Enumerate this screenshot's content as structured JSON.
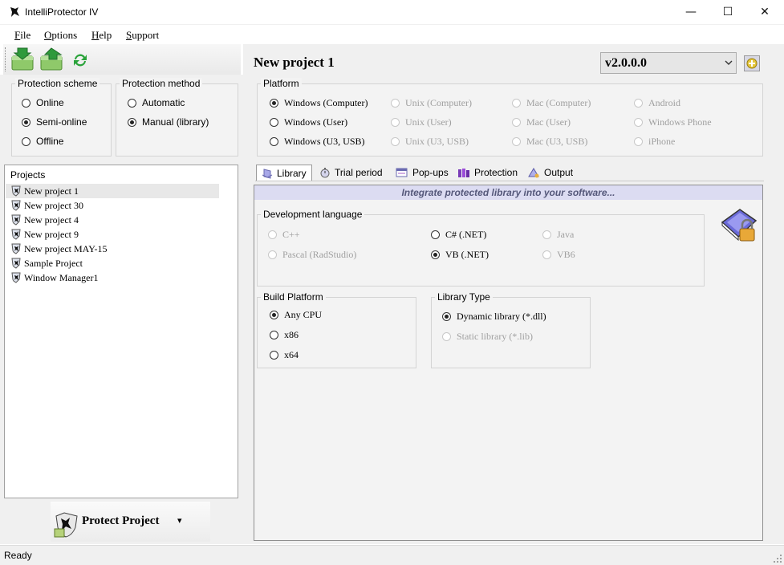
{
  "window": {
    "title": "IntelliProtector IV",
    "minimize": "—",
    "maximize": "☐",
    "close": "✕"
  },
  "menu": {
    "items": [
      {
        "accel": "F",
        "rest": "ile"
      },
      {
        "accel": "O",
        "rest": "ptions"
      },
      {
        "accel": "H",
        "rest": "elp"
      },
      {
        "accel": "S",
        "rest": "upport"
      }
    ]
  },
  "protection_scheme": {
    "label": "Protection scheme",
    "options": [
      "Online",
      "Semi-online",
      "Offline"
    ],
    "selected": "Semi-online"
  },
  "protection_method": {
    "label": "Protection method",
    "options": [
      "Automatic",
      "Manual (library)"
    ],
    "selected": "Manual (library)"
  },
  "projects": {
    "label": "Projects",
    "items": [
      "New project 1",
      "New project 30",
      "New project 4",
      "New project 9",
      "New project MAY-15",
      "Sample Project",
      "Window Manager1"
    ],
    "selected": "New project 1"
  },
  "protect_button": {
    "label": "Protect Project",
    "arrow": "▾"
  },
  "header": {
    "project_title": "New project 1",
    "version": "v2.0.0.0"
  },
  "platform": {
    "label": "Platform",
    "col1": [
      "Windows (Computer)",
      "Windows (User)",
      "Windows (U3, USB)"
    ],
    "col2": [
      "Unix (Computer)",
      "Unix (User)",
      "Unix (U3, USB)"
    ],
    "col3": [
      "Mac (Computer)",
      "Mac (User)",
      "Mac (U3, USB)"
    ],
    "col4": [
      "Android",
      "Windows Phone",
      "iPhone"
    ],
    "selected": "Windows (Computer)"
  },
  "tabs": [
    "Library",
    "Trial period",
    "Pop-ups",
    "Protection",
    "Output"
  ],
  "active_tab": "Library",
  "library": {
    "banner": "Integrate protected library into your software...",
    "dev_language": {
      "label": "Development language",
      "options": [
        "C++",
        "Pascal (RadStudio)",
        "C# (.NET)",
        "VB (.NET)",
        "Java",
        "VB6"
      ],
      "selected": "VB (.NET)"
    },
    "build_platform": {
      "label": "Build Platform",
      "options": [
        "Any CPU",
        "x86",
        "x64"
      ],
      "selected": "Any CPU"
    },
    "library_type": {
      "label": "Library Type",
      "options": [
        "Dynamic library (*.dll)",
        "Static library (*.lib)"
      ],
      "selected": "Dynamic library (*.dll)"
    }
  },
  "status": {
    "text": "Ready"
  },
  "colors": {
    "banner_bg": "#dcdcf2",
    "banner_text": "#55587a",
    "selected_row": "#e8e8e8"
  }
}
